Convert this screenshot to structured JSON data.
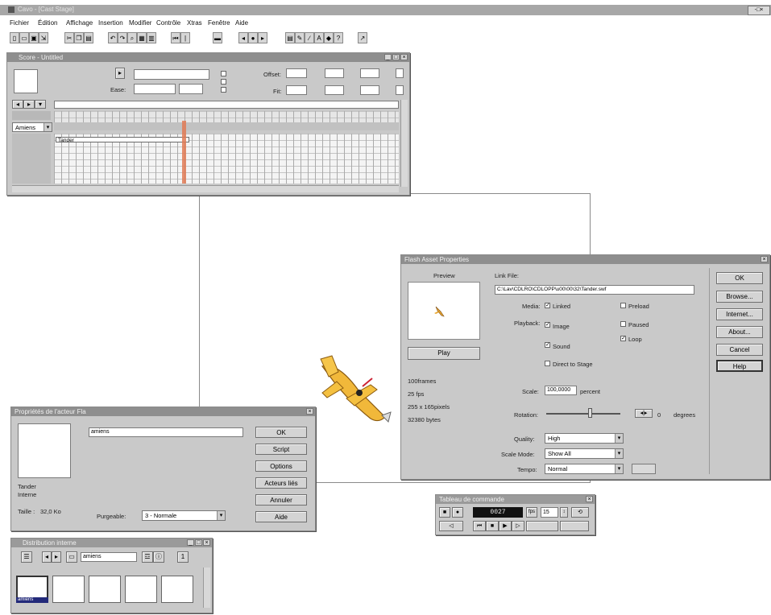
{
  "app": {
    "title": "Cavo - [Cast Stage]",
    "menu": [
      "Fichier",
      "Édition",
      "Affichage",
      "Insertion",
      "Modifier",
      "Contrôle",
      "Xtras",
      "Fenêtre",
      "Aide"
    ],
    "toolbar_icons": [
      "new-icon",
      "open-icon",
      "save-icon",
      "import-icon",
      "cut-icon",
      "copy-icon",
      "paste-icon",
      "undo-icon",
      "redo-icon",
      "find-icon",
      "play-icon",
      "stop-icon",
      "rewind-icon",
      "cast-icon",
      "script-icon",
      "message-icon",
      "help-icon"
    ]
  },
  "score": {
    "title": "Score - Untitled",
    "ease_label": "Ease:",
    "offset_label": "Offset:",
    "fit_label": "Fit:",
    "channel_label": "Amiens",
    "sprite_label": "Tander",
    "playhead_color": "#e07a55"
  },
  "flash_props": {
    "title": "Flash Asset Properties",
    "preview_label": "Preview",
    "play_button": "Play",
    "link_file_label": "Link File:",
    "link_path": "C:\\Lav\\CDLRO\\CDLOPP\\u00\\00\\32\\Tander.swf",
    "media_label": "Media:",
    "media_linked": "Linked",
    "media_preload": "Preload",
    "playback_label": "Playback:",
    "pb_image": "Image",
    "pb_pausecd": "Paused",
    "pb_sound": "Sound",
    "pb_loop": "Loop",
    "pb_direct": "Direct to Stage",
    "info_frames": "100frames",
    "info_fps": "25 fps",
    "info_size": "255 x 165pixels",
    "info_bytes": "32380 bytes",
    "scale_label": "Scale:",
    "scale_value": "100,0000",
    "scale_unit": "percent",
    "rotation_label": "Rotation:",
    "rotation_value": "0",
    "rotation_unit": "degrees",
    "quality_label": "Quality:",
    "quality_value": "High",
    "scale_mode_label": "Scale Mode:",
    "scale_mode_value": "Show All",
    "tempo_label": "Tempo:",
    "tempo_value": "Normal",
    "buttons": {
      "ok": "OK",
      "browse": "Browse...",
      "internet": "Internet...",
      "about": "About...",
      "cancel": "Cancel",
      "help": "Help"
    }
  },
  "cast_props": {
    "title": "Propriétés de l'acteur Fla",
    "name_value": "amiens",
    "cast_name": "Tander",
    "cast_type": "Interne",
    "size_label": "Taille :",
    "size_value": "32,0 Ko",
    "unload_label": "Purgeable:",
    "unload_value": "3 - Normale",
    "buttons": [
      "OK",
      "Script",
      "Options",
      "Acteurs liés",
      "Annuler",
      "Aide"
    ]
  },
  "control": {
    "title": "Tableau de commande",
    "frame_counter": "0027",
    "tempo_value": "15"
  },
  "cast_window": {
    "title": "Distribution interne",
    "name_field": "amiens",
    "selected_member": "amiens"
  }
}
